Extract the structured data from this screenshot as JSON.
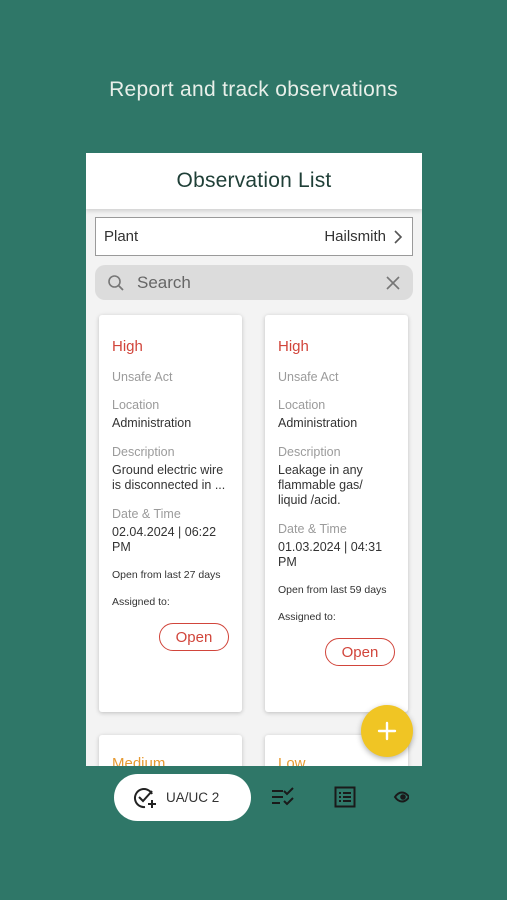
{
  "tagline": "Report and track observations",
  "header": {
    "title": "Observation List"
  },
  "plant": {
    "label": "Plant",
    "value": "Hailsmith"
  },
  "search": {
    "placeholder": "Search"
  },
  "cards": [
    {
      "priority": "High",
      "category": "Unsafe Act",
      "location_label": "Location",
      "location": "Administration",
      "description_label": "Description",
      "description": "Ground electric wire is disconnected in ...",
      "datetime_label": "Date & Time",
      "datetime": "02.04.2024 | 06:22 PM",
      "open_since": "Open from last 27 days",
      "assigned_label": "Assigned to:",
      "status": "Open"
    },
    {
      "priority": "High",
      "category": "Unsafe Act",
      "location_label": "Location",
      "location": "Administration",
      "description_label": "Description",
      "description": "Leakage in any flammable gas/ liquid /acid.",
      "datetime_label": "Date & Time",
      "datetime": "01.03.2024 | 04:31 PM",
      "open_since": "Open from last 59 days",
      "assigned_label": "Assigned to:",
      "status": "Open"
    },
    {
      "priority": "Medium"
    },
    {
      "priority": "Low"
    }
  ],
  "fab": {
    "icon": "plus-icon",
    "color": "#f0c524"
  },
  "bottom_nav": {
    "active_label": "UA/UC 2",
    "active_icon": "check-circle-add-icon",
    "items": [
      "checklist-icon",
      "list-icon",
      "eye-icon"
    ]
  },
  "colors": {
    "background": "#2f7768",
    "high": "#d1453b",
    "medium": "#e69a32",
    "accent": "#f0c524"
  }
}
